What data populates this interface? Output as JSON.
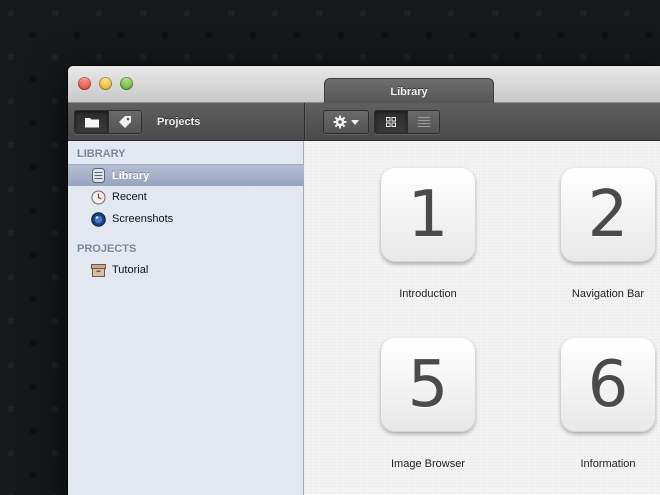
{
  "window": {
    "tab_title": "Library"
  },
  "toolbar": {
    "projects_label": "Projects",
    "view_mode": "grid"
  },
  "sidebar": {
    "sections": [
      {
        "heading": "LIBRARY",
        "items": [
          {
            "label": "Library",
            "icon": "library-icon",
            "selected": true
          },
          {
            "label": "Recent",
            "icon": "clock-icon",
            "selected": false
          },
          {
            "label": "Screenshots",
            "icon": "screenshots-icon",
            "selected": false
          }
        ]
      },
      {
        "heading": "PROJECTS",
        "items": [
          {
            "label": "Tutorial",
            "icon": "box-icon",
            "selected": false
          }
        ]
      }
    ]
  },
  "content": {
    "tiles": [
      {
        "number": "1",
        "label": "Introduction"
      },
      {
        "number": "2",
        "label": "Navigation Bar"
      },
      {
        "number": "5",
        "label": "Image Browser"
      },
      {
        "number": "6",
        "label": "Information"
      }
    ]
  },
  "colors": {
    "selection": "#96a4bf",
    "sidebar_bg": "#e3e7ef",
    "toolbar_bg": "#4a4a4a"
  }
}
